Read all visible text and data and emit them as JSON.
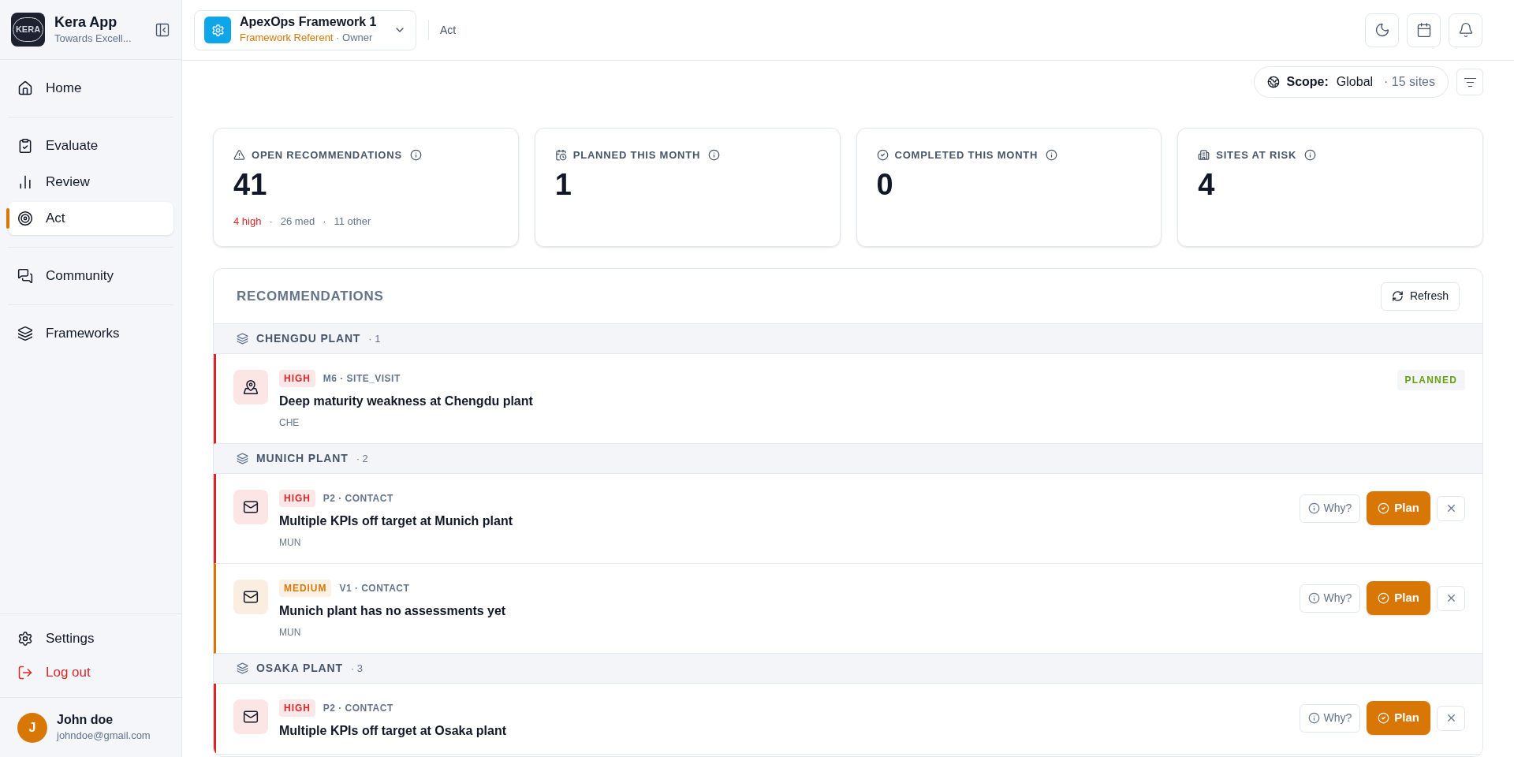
{
  "app": {
    "name": "Kera App",
    "tagline": "Towards Excell...",
    "logo": "KERA"
  },
  "nav_sections": [
    {
      "items": [
        {
          "label": "Home",
          "selected": false
        }
      ]
    },
    {
      "items": [
        {
          "label": "Evaluate",
          "selected": false
        },
        {
          "label": "Review",
          "selected": false
        },
        {
          "label": "Act",
          "selected": true
        }
      ]
    },
    {
      "items": [
        {
          "label": "Community",
          "selected": false
        }
      ]
    },
    {
      "items": [
        {
          "label": "Frameworks",
          "selected": false
        }
      ]
    }
  ],
  "sidebar_footer": {
    "settings": "Settings",
    "logout": "Log out"
  },
  "user": {
    "initial": "J",
    "name": "John doe",
    "email": "johndoe@gmail.com"
  },
  "framework_picker": {
    "name": "ApexOps Framework 1",
    "role": "Framework Referent",
    "separator": "·",
    "access": "Owner"
  },
  "breadcrumb": "Act",
  "scope": {
    "label": "Scope:",
    "value": "Global",
    "sites": "· 15 sites"
  },
  "stats": [
    {
      "label": "OPEN RECOMMENDATIONS",
      "value": "41",
      "separator": "·",
      "breakdown": [
        {
          "text": "4 high",
          "kind": "high"
        },
        {
          "text": "26 med",
          "kind": "other"
        },
        {
          "text": "11 other",
          "kind": "other"
        }
      ]
    },
    {
      "label": "PLANNED THIS MONTH",
      "value": "1"
    },
    {
      "label": "COMPLETED THIS MONTH",
      "value": "0"
    },
    {
      "label": "SITES AT RISK",
      "value": "4"
    }
  ],
  "recommendations": {
    "title": "RECOMMENDATIONS",
    "refresh": "Refresh",
    "groups": [
      {
        "name": "CHENGDU PLANT",
        "count": "· 1",
        "items": [
          {
            "color": "#dc2626",
            "badge": "HIGH",
            "code": "M6 · SITE_VISIT",
            "kind": "site_visit",
            "title": "Deep maturity weakness at Chengdu plant",
            "site": "CHE",
            "status": "PLANNED"
          }
        ]
      },
      {
        "name": "MUNICH PLANT",
        "count": "· 2",
        "items": [
          {
            "color": "#dc2626",
            "badge": "HIGH",
            "code": "P2 · CONTACT",
            "kind": "contact",
            "title": "Multiple KPIs off target at Munich plant",
            "site": "MUN",
            "actions": {
              "why": "Why?",
              "plan": "Plan"
            }
          },
          {
            "color": "#d97706",
            "badge": "MEDIUM",
            "code": "V1 · CONTACT",
            "kind": "contact",
            "title": "Munich plant has no assessments yet",
            "site": "MUN",
            "actions": {
              "why": "Why?",
              "plan": "Plan"
            }
          }
        ]
      },
      {
        "name": "OSAKA PLANT",
        "count": "· 3",
        "items": [
          {
            "color": "#dc2626",
            "badge": "HIGH",
            "code": "P2 · CONTACT",
            "kind": "contact",
            "title": "Multiple KPIs off target at Osaka plant",
            "actions": {
              "why": "Why?",
              "plan": "Plan"
            }
          }
        ]
      }
    ]
  }
}
